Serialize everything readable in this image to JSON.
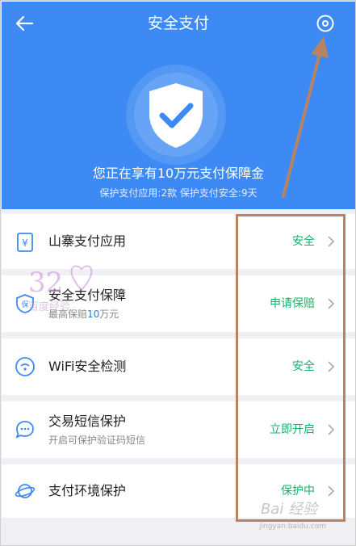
{
  "header": {
    "title": "安全支付",
    "headline": "您正在享有10万元支付保障金",
    "subline": "保护支付应用:2款   保护支付安全:9天"
  },
  "list": [
    {
      "label": "山寨支付应用",
      "sub": "",
      "status": "安全",
      "icon": "yuan-icon"
    },
    {
      "label": "安全支付保障",
      "sub_prefix": "最高保赔",
      "sub_highlight": "10",
      "sub_suffix": "万元",
      "status": "申请保赔",
      "icon": "protect-icon"
    },
    {
      "label": "WiFi安全检测",
      "sub": "",
      "status": "安全",
      "icon": "wifi-icon"
    },
    {
      "label": "交易短信保护",
      "sub": "开启可保护验证码短信",
      "status": "立即开启",
      "icon": "message-icon"
    },
    {
      "label": "支付环境保护",
      "sub": "",
      "status": "保护中",
      "icon": "planet-icon"
    }
  ],
  "icon_labels": {
    "protect": "保"
  },
  "watermark": {
    "logo_text": "百度经验",
    "brand": "Bai  经验",
    "url": "jingyan.baidu.com"
  },
  "colors": {
    "header_bg": "#3d8af4",
    "status_green": "#17b26a",
    "icon_blue": "#3d8af4",
    "annotation": "#b78363"
  }
}
